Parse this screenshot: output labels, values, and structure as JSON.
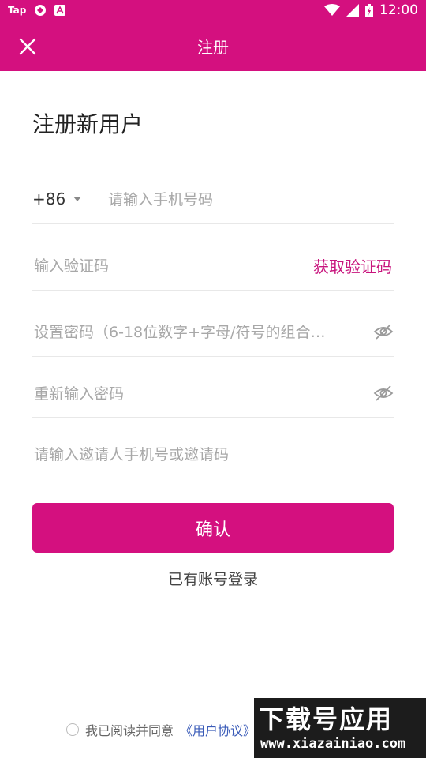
{
  "status_bar": {
    "left_icons": [
      "tap-icon",
      "sync-icon",
      "app-icon"
    ],
    "tap_label": "Tap",
    "time": "12:00",
    "right_icons": [
      "wifi-icon",
      "signal-icon",
      "battery-icon"
    ]
  },
  "app_bar": {
    "title": "注册",
    "close_icon": "close-icon"
  },
  "form": {
    "heading": "注册新用户",
    "country_code": "+86",
    "phone_placeholder": "请输入手机号码",
    "code_placeholder": "输入验证码",
    "get_code_label": "获取验证码",
    "password_placeholder": "设置密码（6-18位数字+字母/符号的组合…",
    "password_confirm_placeholder": "重新输入密码",
    "invite_placeholder": "请输入邀请人手机号或邀请码",
    "eye_icon": "eye-off-icon"
  },
  "actions": {
    "confirm_label": "确认",
    "login_link": "已有账号登录"
  },
  "agreement": {
    "prefix": "我已阅读并同意",
    "user_agreement": "《用户协议》"
  },
  "watermark": {
    "title": "下载号应用",
    "subtitle": "www.xiazainiao.com"
  },
  "colors": {
    "brand": "#d4107f",
    "accent_text": "#c8147d",
    "link": "#3a5bb8"
  }
}
